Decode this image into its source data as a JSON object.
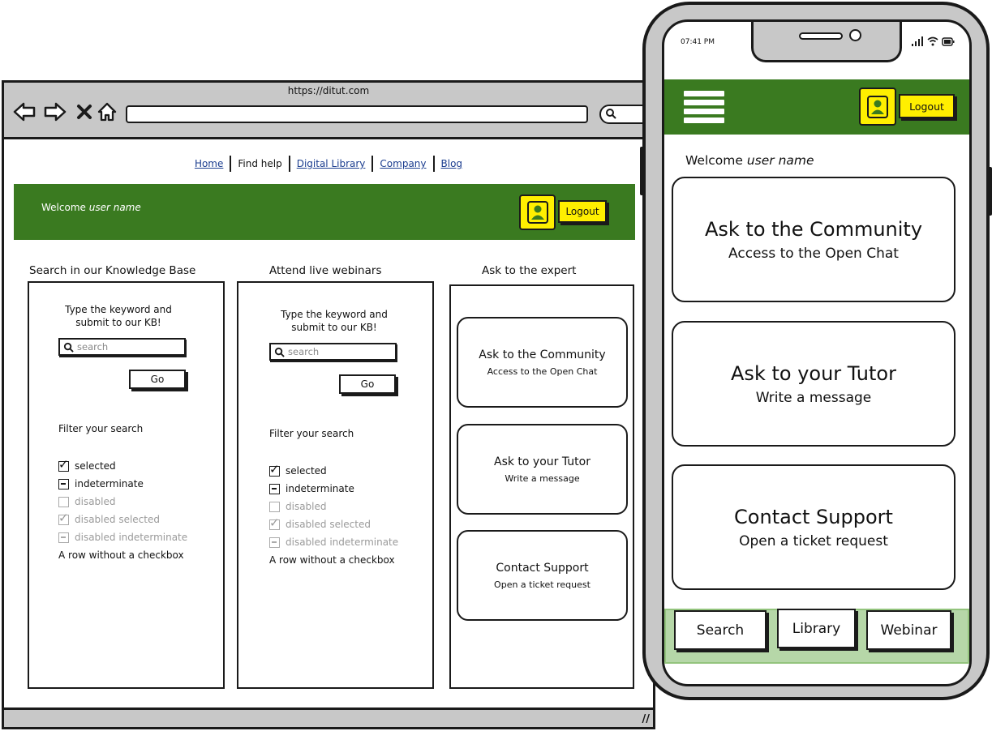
{
  "browser": {
    "url": "https://ditut.com",
    "nav_links": [
      {
        "label": "Home",
        "active": false
      },
      {
        "label": "Find help",
        "active": true
      },
      {
        "label": "Digital Library",
        "active": false
      },
      {
        "label": "Company",
        "active": false
      },
      {
        "label": "Blog",
        "active": false
      }
    ],
    "header": {
      "welcome": "Welcome",
      "user_name": "user name",
      "logout_label": "Logout",
      "color": "#3a7a20",
      "accent": "#ffef00"
    },
    "columns": {
      "kb": {
        "title": "Search in our Knowledge Base",
        "keyword_text": "Type the keyword and submit to our KB!",
        "search_placeholder": "search",
        "go_label": "Go",
        "filter_title": "Filter your search",
        "checkboxes": [
          {
            "label": "selected",
            "state": "checked",
            "disabled": false
          },
          {
            "label": "indeterminate",
            "state": "indeterminate",
            "disabled": false
          },
          {
            "label": "disabled",
            "state": "unchecked",
            "disabled": true
          },
          {
            "label": "disabled selected",
            "state": "checked",
            "disabled": true
          },
          {
            "label": "disabled indeterminate",
            "state": "indeterminate",
            "disabled": true
          }
        ],
        "row_without_checkbox": "A row without a checkbox"
      },
      "webinars": {
        "title": "Attend live webinars",
        "keyword_text": "Type the keyword and submit to our KB!",
        "search_placeholder": "search",
        "go_label": "Go",
        "filter_title": "Filter your search",
        "checkboxes": [
          {
            "label": "selected",
            "state": "checked",
            "disabled": false
          },
          {
            "label": "indeterminate",
            "state": "indeterminate",
            "disabled": false
          },
          {
            "label": "disabled",
            "state": "unchecked",
            "disabled": true
          },
          {
            "label": "disabled selected",
            "state": "checked",
            "disabled": true
          },
          {
            "label": "disabled indeterminate",
            "state": "indeterminate",
            "disabled": true
          }
        ],
        "row_without_checkbox": "A row without a checkbox"
      },
      "expert": {
        "title": "Ask to the expert",
        "cards": [
          {
            "title": "Ask to the Community",
            "subtitle": "Access to the Open Chat"
          },
          {
            "title": "Ask to your Tutor",
            "subtitle": "Write a message"
          },
          {
            "title": "Contact Support",
            "subtitle": "Open a ticket request"
          }
        ]
      }
    }
  },
  "phone": {
    "time": "07:41 PM",
    "logout_label": "Logout",
    "welcome": "Welcome",
    "user_name": "user name",
    "cards": [
      {
        "title": "Ask to the Community",
        "subtitle": "Access to the Open Chat"
      },
      {
        "title": "Ask to your Tutor",
        "subtitle": "Write a message"
      },
      {
        "title": "Contact Support",
        "subtitle": "Open a ticket request"
      }
    ],
    "tabs": [
      "Search",
      "Library",
      "Webinar"
    ],
    "tabbar_color": "#b6d7a8"
  }
}
